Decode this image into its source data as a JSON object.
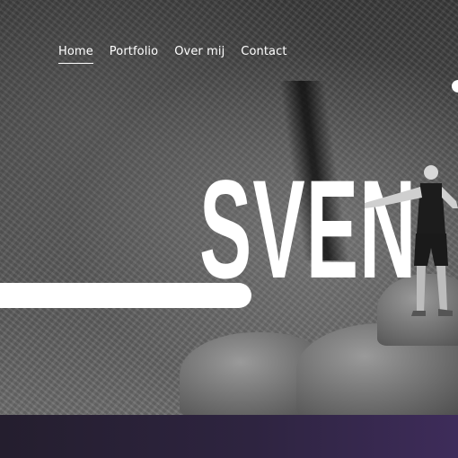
{
  "nav": {
    "items": [
      {
        "label": "Home",
        "active": true
      },
      {
        "label": "Portfolio",
        "active": false
      },
      {
        "label": "Over mij",
        "active": false
      },
      {
        "label": "Contact",
        "active": false
      }
    ]
  },
  "hero": {
    "title": "SVEN",
    "background": "black-and-white mountain canyon photo",
    "person_icon": "person-arms-outstretched"
  },
  "colors": {
    "text": "#ffffff",
    "footer_start": "#241e2e",
    "footer_end": "#3e2c5a"
  }
}
